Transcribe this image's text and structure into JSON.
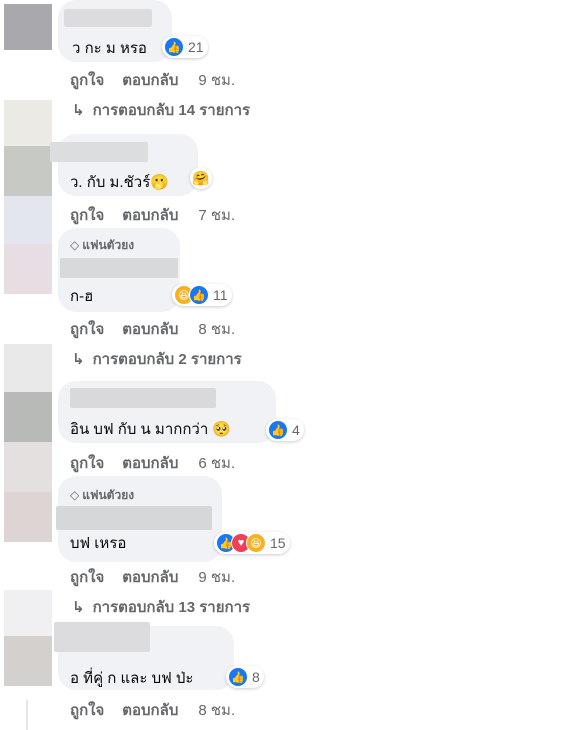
{
  "labels": {
    "like": "ถูกใจ",
    "reply": "ตอบกลับ"
  },
  "fan_badge": "แฟนตัวยง",
  "comments": [
    {
      "text": "ว กะ ม หรอ",
      "time": "9 ชม.",
      "reaction_count": "21",
      "replies": "การตอบกลับ 14 รายการ"
    },
    {
      "text": "ว. กับ ม.ชัวร์🫢",
      "time": "7 ชม."
    },
    {
      "text": "ก-ฮ",
      "time": "8 ชม.",
      "reaction_count": "11",
      "replies": "การตอบกลับ 2 รายการ"
    },
    {
      "text": "อิน บฟ กับ น มากกว่า 🥺",
      "time": "6 ชม.",
      "reaction_count": "4"
    },
    {
      "text": "บฟ เหรอ",
      "time": "9 ชม.",
      "reaction_count": "15",
      "replies": "การตอบกลับ 13 รายการ"
    },
    {
      "text": "อ ที่คู่ ก และ บฟ ป่ะ",
      "time": "8 ชม.",
      "reaction_count": "8"
    }
  ],
  "colors": {
    "bubble": "#f0f2f5",
    "meta_text": "#65676b",
    "like_blue": "#1877f2",
    "heart_red": "#f33e58",
    "haha_yellow": "#f7b125"
  },
  "icons": [
    "like-icon",
    "heart-icon",
    "haha-icon",
    "hug-emoji-icon",
    "diamond-icon",
    "reply-arrow-icon"
  ]
}
